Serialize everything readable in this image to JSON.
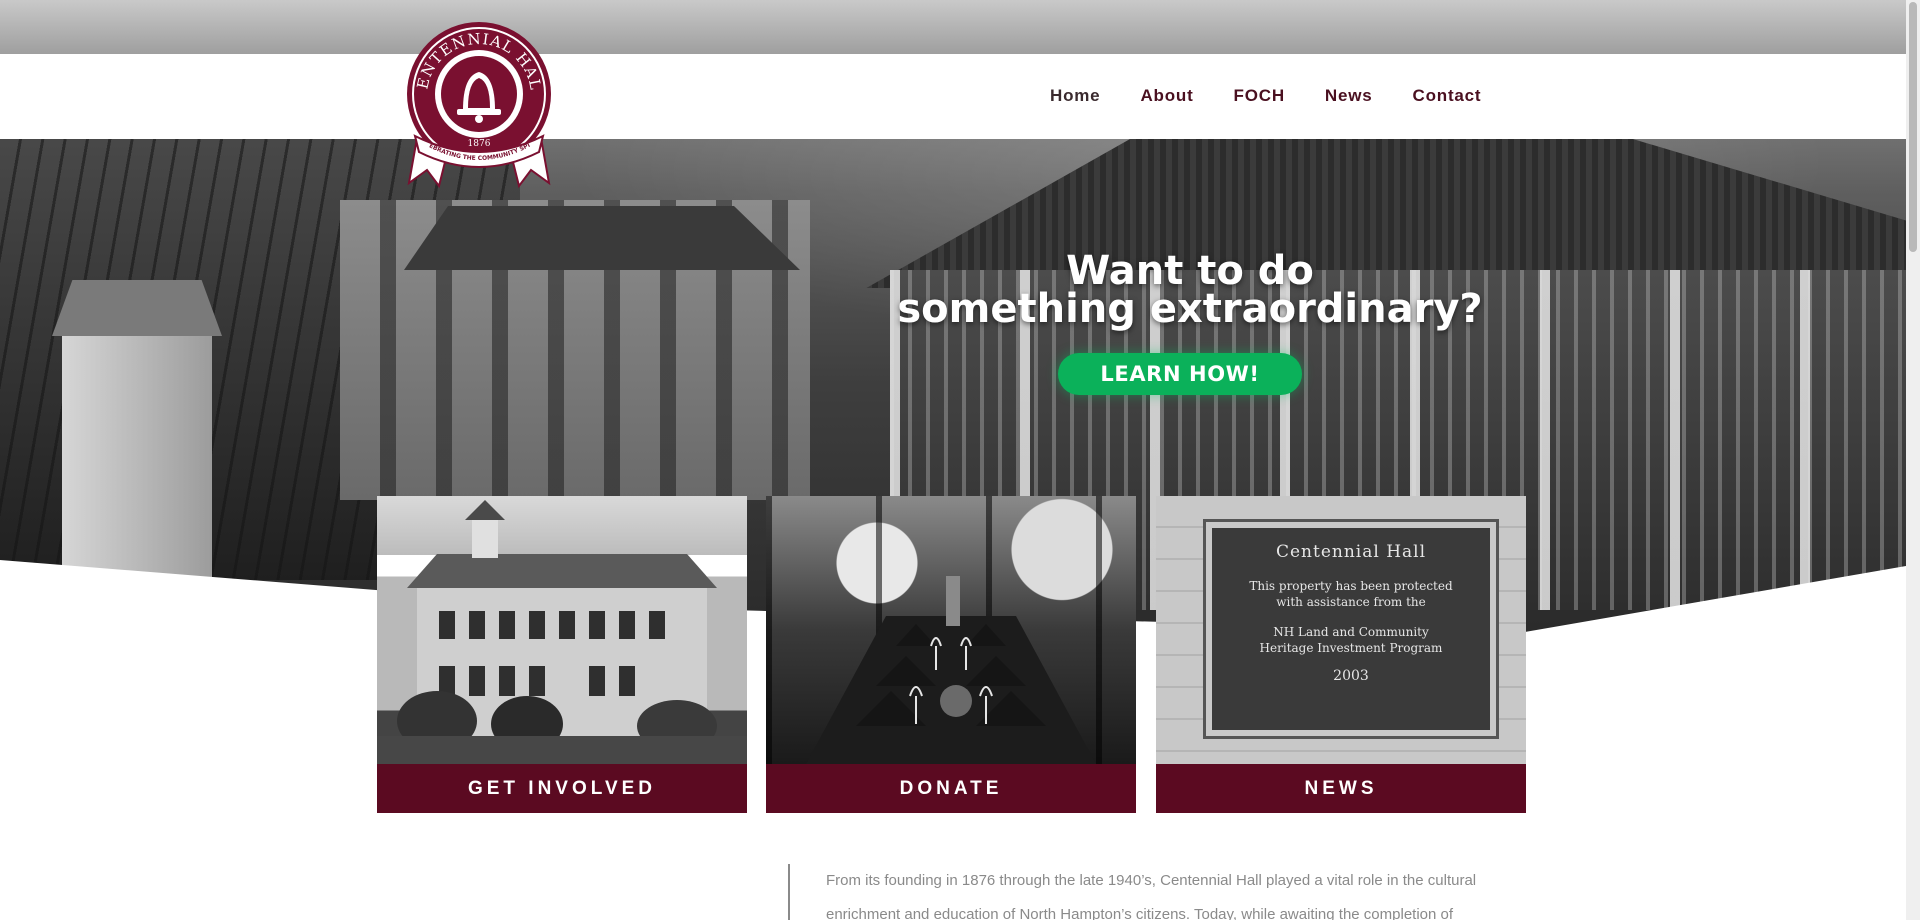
{
  "logo": {
    "top_text": "CENTENNIAL HALL",
    "year": "1876",
    "ribbon": "CELEBRATING THE COMMUNITY SPIRIT",
    "color": "#7a1030"
  },
  "nav": {
    "items": [
      {
        "label": "Home"
      },
      {
        "label": "About"
      },
      {
        "label": "FOCH"
      },
      {
        "label": "News"
      },
      {
        "label": "Contact"
      }
    ],
    "color": "#4a1020"
  },
  "hero": {
    "line1": "Want to do",
    "line2": "something extraordinary?",
    "cta": "LEARN HOW!",
    "cta_color": "#0bb15a"
  },
  "cards": [
    {
      "label": "GET INVOLVED"
    },
    {
      "label": "DONATE"
    },
    {
      "label": "NEWS"
    }
  ],
  "plaque": {
    "title": "Centennial Hall",
    "line1": "This property has been protected",
    "line2": "with assistance from the",
    "line3": "NH Land and Community",
    "line4": "Heritage Investment Program",
    "year": "2003"
  },
  "intro": {
    "text": "From its founding in 1876 through the late 1940’s, Centennial Hall played a vital role in the cultural enrichment and education of North Hampton’s citizens. Today, while awaiting the completion of"
  },
  "colors": {
    "brand": "#5b0a21",
    "text_muted": "#8a8a8a"
  }
}
